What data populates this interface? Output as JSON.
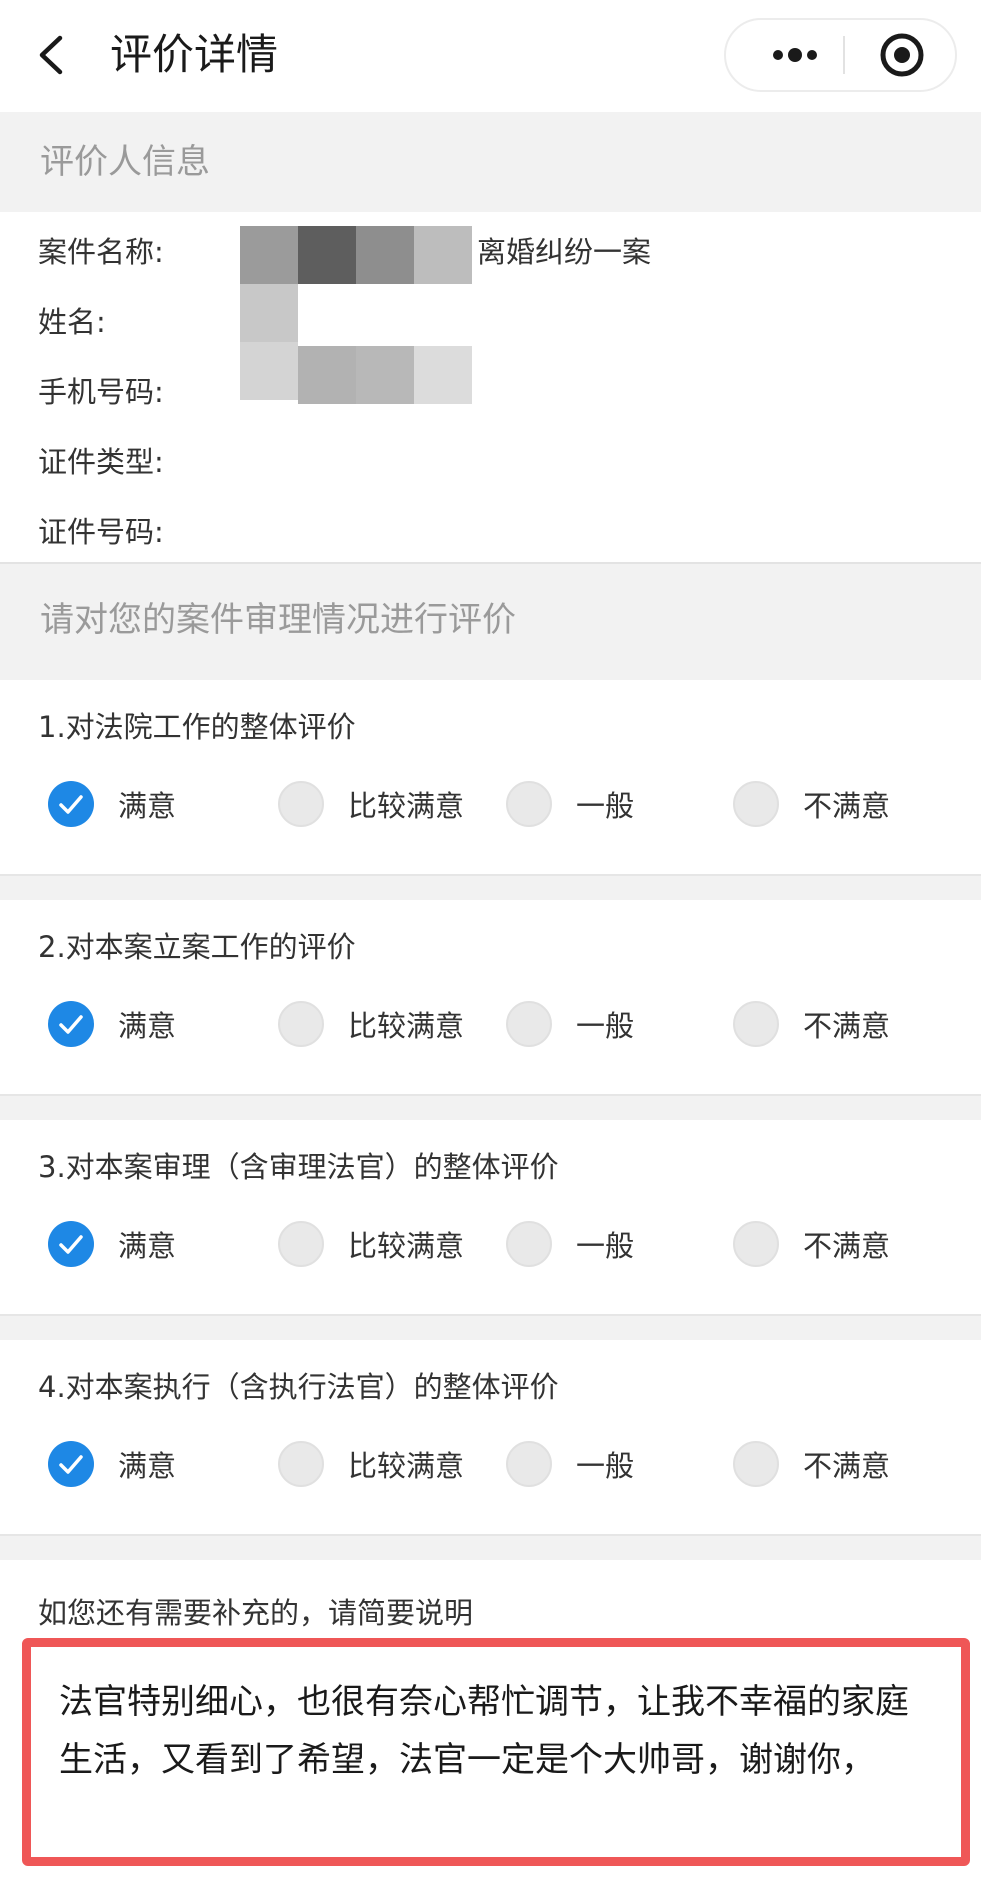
{
  "header": {
    "title": "评价详情",
    "back_icon": "chevron-left-icon",
    "more_icon": "more-dots-icon",
    "close_icon": "target-circle-icon"
  },
  "evaluator": {
    "section_title": "评价人信息",
    "fields": [
      {
        "label": "案件名称:",
        "value": "离婚纠纷一案"
      },
      {
        "label": "姓名:",
        "value": ""
      },
      {
        "label": "手机号码:",
        "value": ""
      },
      {
        "label": "证件类型:",
        "value": ""
      },
      {
        "label": "证件号码:",
        "value": ""
      }
    ]
  },
  "evaluation": {
    "section_title": "请对您的案件审理情况进行评价",
    "options": [
      "满意",
      "比较满意",
      "一般",
      "不满意"
    ],
    "questions": [
      {
        "title": "1.对法院工作的整体评价",
        "selected": "满意"
      },
      {
        "title": "2.对本案立案工作的评价",
        "selected": "满意"
      },
      {
        "title": "3.对本案审理（含审理法官）的整体评价",
        "selected": "满意"
      },
      {
        "title": "4.对本案执行（含执行法官）的整体评价",
        "selected": "满意"
      }
    ]
  },
  "supplement": {
    "label": "如您还有需要补充的，请简要说明",
    "text": "法官特别细心，也很有奈心帮忙调节，让我不幸福的家庭生活，又看到了希望，法官一定是个大帅哥，谢谢你，"
  },
  "colors": {
    "accent": "#1e88e5",
    "highlight_border": "#ef5757",
    "section_bg": "#f2f2f2"
  }
}
